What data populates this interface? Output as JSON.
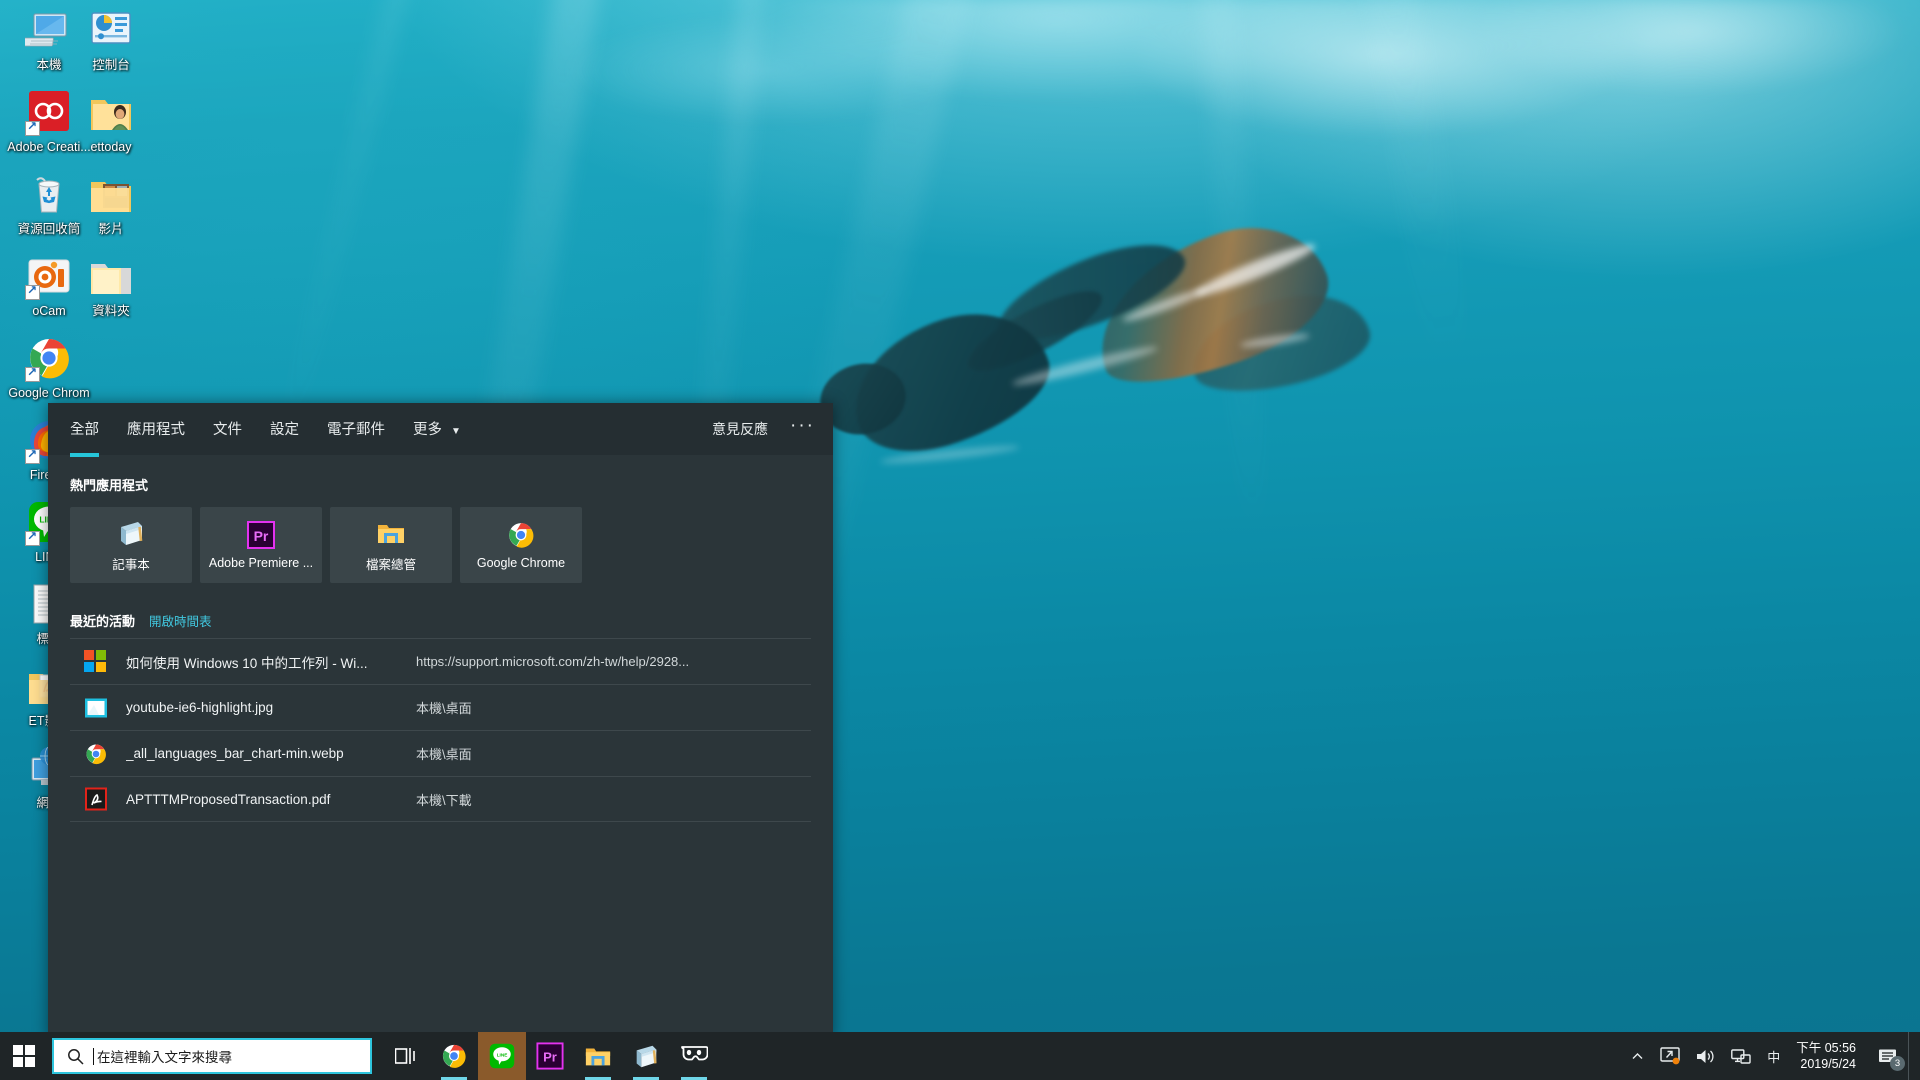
{
  "wallpaper": {
    "description": "underwater-freediver-turquoise"
  },
  "desktop": {
    "icons": [
      {
        "label": "本機",
        "icon": "this-pc-icon",
        "col": 0,
        "row": 0
      },
      {
        "label": "控制台",
        "icon": "control-panel-icon",
        "col": 1,
        "row": 0
      },
      {
        "label": "Adobe Creati...",
        "icon": "adobe-cc-icon",
        "col": 0,
        "row": 1
      },
      {
        "label": "ettoday",
        "icon": "user-folder-icon",
        "col": 1,
        "row": 1
      },
      {
        "label": "資源回收筒",
        "icon": "recycle-bin-icon",
        "col": 0,
        "row": 2
      },
      {
        "label": "影片",
        "icon": "videos-folder-icon",
        "col": 1,
        "row": 2
      },
      {
        "label": "oCam",
        "icon": "ocam-icon",
        "col": 0,
        "row": 3
      },
      {
        "label": "資料夾",
        "icon": "folder-icon",
        "col": 1,
        "row": 3
      },
      {
        "label": "Google Chrom",
        "icon": "chrome-icon",
        "col": 0,
        "row": 4
      },
      {
        "label": "Firefox",
        "icon": "firefox-icon",
        "col": 0,
        "row": 5
      },
      {
        "label": "LINE",
        "icon": "line-icon",
        "col": 0,
        "row": 6
      },
      {
        "label": "標語",
        "icon": "text-document-icon",
        "col": 0,
        "row": 7
      },
      {
        "label": "ET影片",
        "icon": "pdf-folder-icon",
        "col": 0,
        "row": 8
      },
      {
        "label": "網路",
        "icon": "network-icon",
        "col": 0,
        "row": 9
      }
    ]
  },
  "search_panel": {
    "tabs": [
      {
        "label": "全部",
        "active": true,
        "has_caret": false
      },
      {
        "label": "應用程式",
        "active": false,
        "has_caret": false
      },
      {
        "label": "文件",
        "active": false,
        "has_caret": false
      },
      {
        "label": "設定",
        "active": false,
        "has_caret": false
      },
      {
        "label": "電子郵件",
        "active": false,
        "has_caret": false
      },
      {
        "label": "更多",
        "active": false,
        "has_caret": true
      }
    ],
    "feedback_label": "意見反應",
    "more_menu_label": "···",
    "top_apps_title": "熱門應用程式",
    "top_apps": [
      {
        "label": "記事本",
        "icon": "notepad-icon"
      },
      {
        "label": "Adobe Premiere ...",
        "icon": "premiere-pro-icon"
      },
      {
        "label": "檔案總管",
        "icon": "file-explorer-icon"
      },
      {
        "label": "Google Chrome",
        "icon": "chrome-icon"
      }
    ],
    "activity_title": "最近的活動",
    "timeline_link": "開啟時間表",
    "activities": [
      {
        "title": "如何使用 Windows 10 中的工作列 - Wi...",
        "subtitle": "https://support.microsoft.com/zh-tw/help/2928...",
        "icon": "microsoft-logo-icon"
      },
      {
        "title": "youtube-ie6-highlight.jpg",
        "subtitle": "本機\\桌面",
        "icon": "photo-icon"
      },
      {
        "title": "_all_languages_bar_chart-min.webp",
        "subtitle": "本機\\桌面",
        "icon": "chrome-icon"
      },
      {
        "title": "APTTTMProposedTransaction.pdf",
        "subtitle": "本機\\下載",
        "icon": "pdf-icon"
      }
    ]
  },
  "taskbar": {
    "start_label": "start-button",
    "search_placeholder": "在這裡輸入文字來搜尋",
    "search_value": "",
    "task_view_label": "工作檢視",
    "apps": [
      {
        "name": "chrome",
        "icon": "chrome-icon",
        "running": true,
        "active": false
      },
      {
        "name": "line",
        "icon": "line-icon",
        "running": true,
        "active": true
      },
      {
        "name": "premiere",
        "icon": "premiere-pro-icon",
        "running": false,
        "active": false
      },
      {
        "name": "file-explorer",
        "icon": "file-explorer-icon",
        "running": true,
        "active": false
      },
      {
        "name": "notepad",
        "icon": "notepad-icon",
        "running": true,
        "active": false
      },
      {
        "name": "mixed-reality",
        "icon": "vr-headset-icon",
        "running": true,
        "active": false
      }
    ],
    "tray": {
      "overflow_label": "^",
      "ime_label": "中",
      "time": "下午 05:56",
      "date": "2019/5/24",
      "notification_count": "3"
    }
  },
  "colors": {
    "accent_cyan": "#26c6da",
    "panel_bg": "#2b3539",
    "panel_header_bg": "#252e32",
    "tile_bg": "#3a4549",
    "taskbar_bg": "#1f2527",
    "link_cyan": "#41c8e0",
    "active_app_bg": "#8a5a2b"
  }
}
